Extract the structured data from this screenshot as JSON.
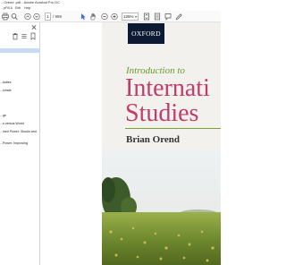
{
  "window": {
    "title": "...Orend .pdf - Adobe Acrobat Pro DC"
  },
  "menu": {
    "items": [
      "...p",
      "Fill &",
      "Edit",
      "Help"
    ]
  },
  "toolbar": {
    "page_current": "1",
    "page_total": "/ 989",
    "zoom": "125%",
    "icons": [
      "print-icon",
      "mail-icon",
      "search-icon",
      "up-arrow-icon",
      "down-arrow-icon",
      "cursor-icon",
      "hand-icon",
      "zoom-out-icon",
      "zoom-in-icon",
      "fit-page-icon",
      "scroll-mode-icon",
      "comment-icon",
      "pen-icon"
    ]
  },
  "panel": {
    "tool_icons": [
      "delete-icon",
      "options-icon",
      "add-bookmark-icon"
    ],
    "bookmarks": [
      "...tudies",
      "...ionale",
      "...ge",
      "...s versus World",
      "...ined Power: Stocks and",
      "...Power: Improving"
    ]
  },
  "cover": {
    "publisher": "OXFORD",
    "subtitle_line": "Introduction to",
    "title_line1": "Internati",
    "title_line2": "Studies",
    "author": "Brian Orend"
  }
}
